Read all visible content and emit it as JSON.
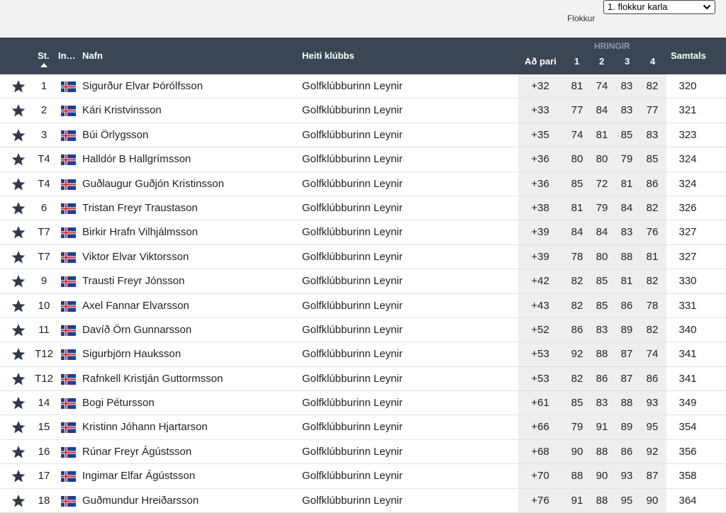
{
  "filter": {
    "selected": "1. flokkur karla",
    "label": "Flokkur"
  },
  "header": {
    "position": "St.",
    "initials": "In…",
    "name": "Nafn",
    "club": "Heiti klúbbs",
    "rounds_group": "HRINGIR",
    "to_par": "Að pari",
    "r1": "1",
    "r2": "2",
    "r3": "3",
    "r4": "4",
    "total": "Samtals"
  },
  "colors": {
    "header_bg": "#3a4653",
    "star": "#2f3b4a",
    "flag_blue": "#1a3f95",
    "flag_red": "#d3262f"
  },
  "rows": [
    {
      "pos": "1",
      "name": "Sigurður Elvar Þórólfsson",
      "club": "Golfklúbburinn Leynir",
      "pari": "+32",
      "r1": "81",
      "r2": "74",
      "r3": "83",
      "r4": "82",
      "tot": "320"
    },
    {
      "pos": "2",
      "name": "Kári Kristvinsson",
      "club": "Golfklúbburinn Leynir",
      "pari": "+33",
      "r1": "77",
      "r2": "84",
      "r3": "83",
      "r4": "77",
      "tot": "321"
    },
    {
      "pos": "3",
      "name": "Búi Örlygsson",
      "club": "Golfklúbburinn Leynir",
      "pari": "+35",
      "r1": "74",
      "r2": "81",
      "r3": "85",
      "r4": "83",
      "tot": "323"
    },
    {
      "pos": "T4",
      "name": "Halldór B Hallgrímsson",
      "club": "Golfklúbburinn Leynir",
      "pari": "+36",
      "r1": "80",
      "r2": "80",
      "r3": "79",
      "r4": "85",
      "tot": "324"
    },
    {
      "pos": "T4",
      "name": "Guðlaugur Guðjón Kristinsson",
      "club": "Golfklúbburinn Leynir",
      "pari": "+36",
      "r1": "85",
      "r2": "72",
      "r3": "81",
      "r4": "86",
      "tot": "324"
    },
    {
      "pos": "6",
      "name": "Tristan Freyr Traustason",
      "club": "Golfklúbburinn Leynir",
      "pari": "+38",
      "r1": "81",
      "r2": "79",
      "r3": "84",
      "r4": "82",
      "tot": "326"
    },
    {
      "pos": "T7",
      "name": "Birkir Hrafn Vilhjálmsson",
      "club": "Golfklúbburinn Leynir",
      "pari": "+39",
      "r1": "84",
      "r2": "84",
      "r3": "83",
      "r4": "76",
      "tot": "327"
    },
    {
      "pos": "T7",
      "name": "Viktor Elvar Viktorsson",
      "club": "Golfklúbburinn Leynir",
      "pari": "+39",
      "r1": "78",
      "r2": "80",
      "r3": "88",
      "r4": "81",
      "tot": "327"
    },
    {
      "pos": "9",
      "name": "Trausti Freyr Jónsson",
      "club": "Golfklúbburinn Leynir",
      "pari": "+42",
      "r1": "82",
      "r2": "85",
      "r3": "81",
      "r4": "82",
      "tot": "330"
    },
    {
      "pos": "10",
      "name": "Axel Fannar Elvarsson",
      "club": "Golfklúbburinn Leynir",
      "pari": "+43",
      "r1": "82",
      "r2": "85",
      "r3": "86",
      "r4": "78",
      "tot": "331"
    },
    {
      "pos": "11",
      "name": "Davíð Örn Gunnarsson",
      "club": "Golfklúbburinn Leynir",
      "pari": "+52",
      "r1": "86",
      "r2": "83",
      "r3": "89",
      "r4": "82",
      "tot": "340"
    },
    {
      "pos": "T12",
      "name": "Sigurbjörn Hauksson",
      "club": "Golfklúbburinn Leynir",
      "pari": "+53",
      "r1": "92",
      "r2": "88",
      "r3": "87",
      "r4": "74",
      "tot": "341"
    },
    {
      "pos": "T12",
      "name": "Rafnkell Kristján Guttormsson",
      "club": "Golfklúbburinn Leynir",
      "pari": "+53",
      "r1": "82",
      "r2": "86",
      "r3": "87",
      "r4": "86",
      "tot": "341"
    },
    {
      "pos": "14",
      "name": "Bogi Pétursson",
      "club": "Golfklúbburinn Leynir",
      "pari": "+61",
      "r1": "85",
      "r2": "83",
      "r3": "88",
      "r4": "93",
      "tot": "349"
    },
    {
      "pos": "15",
      "name": "Kristinn Jóhann Hjartarson",
      "club": "Golfklúbburinn Leynir",
      "pari": "+66",
      "r1": "79",
      "r2": "91",
      "r3": "89",
      "r4": "95",
      "tot": "354"
    },
    {
      "pos": "16",
      "name": "Rúnar Freyr Ágústsson",
      "club": "Golfklúbburinn Leynir",
      "pari": "+68",
      "r1": "90",
      "r2": "88",
      "r3": "86",
      "r4": "92",
      "tot": "356"
    },
    {
      "pos": "17",
      "name": "Ingimar Elfar Ágústsson",
      "club": "Golfklúbburinn Leynir",
      "pari": "+70",
      "r1": "88",
      "r2": "90",
      "r3": "93",
      "r4": "87",
      "tot": "358"
    },
    {
      "pos": "18",
      "name": "Guðmundur Hreiðarsson",
      "club": "Golfklúbburinn Leynir",
      "pari": "+76",
      "r1": "91",
      "r2": "88",
      "r3": "95",
      "r4": "90",
      "tot": "364"
    }
  ]
}
